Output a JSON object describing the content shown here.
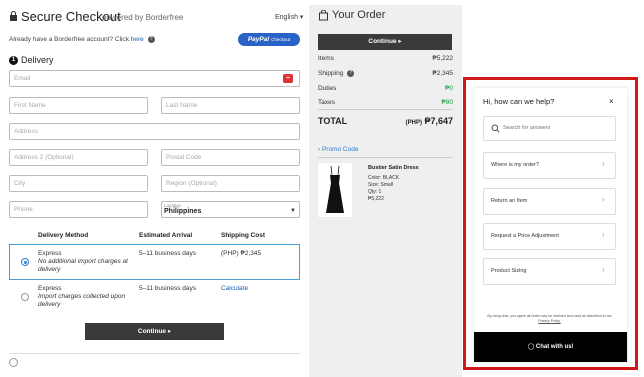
{
  "header": {
    "title": "Secure Checkout",
    "powered_by": "powered by Borderfree",
    "language": "English ▾",
    "account_prompt": "Already have a Borderfree account? Click",
    "account_link": "here",
    "paypal_label": "PayPal",
    "paypal_sub": "Checkout"
  },
  "delivery": {
    "step_number": "1",
    "step_label": "Delivery",
    "fields": {
      "email": "Email",
      "first_name": "First Name",
      "last_name": "Last Name",
      "address": "Address",
      "address2": "Address 2 (Optional)",
      "postal_code": "Postal Code",
      "city": "City",
      "region": "Region (Optional)",
      "phone": "Phone",
      "location_small": "Location",
      "location_value": "Philippines"
    },
    "table_headers": [
      "Delivery Method",
      "Estimated Arrival",
      "Shipping Cost"
    ],
    "options": [
      {
        "method": "Express",
        "note": "No additional import charges at delivery",
        "arrival": "5–11 business days",
        "cost": "(PHP) ₱2,345",
        "selected": true
      },
      {
        "method": "Express",
        "note": "Import charges collected upon delivery",
        "arrival": "5–11 business days",
        "cost": "Calculate",
        "selected": false
      }
    ],
    "continue_label": "Continue ▸"
  },
  "order": {
    "title": "Your Order",
    "continue_label": "Continue ▸",
    "lines": [
      {
        "label": "Items",
        "value": "₱5,222"
      },
      {
        "label": "Shipping",
        "value": "₱2,345"
      },
      {
        "label": "Duties",
        "value": "₱0"
      },
      {
        "label": "Taxes",
        "value": "₱80"
      }
    ],
    "total_label": "TOTAL",
    "total_currency": "(PHP)",
    "total_value": "₱7,647",
    "promo_label": "› Promo Code",
    "product": {
      "name": "Bustier Satin Dress",
      "color": "Color: BLACK",
      "size": "Size: Small",
      "qty": "Qty: 1",
      "price": "₱5,222"
    }
  },
  "help_widget": {
    "title": "Hi, how can we help?",
    "close": "×",
    "search_placeholder": "Search for answers",
    "items": [
      "Where is my order?",
      "Return an Item",
      "Request a Price Adjustment",
      "Product Sizing"
    ],
    "legal_text": "By using chat, you agree all chats may be retained and used as described in our",
    "legal_link": "Privacy Policy.",
    "chat_button": "Chat with us!"
  },
  "colors": {
    "accent_blue": "#2a7fd0",
    "paypal_blue": "#2a63c7",
    "highlight_red": "#d01818",
    "dark_button": "#3a3a3a",
    "green": "#1a9a3a"
  }
}
